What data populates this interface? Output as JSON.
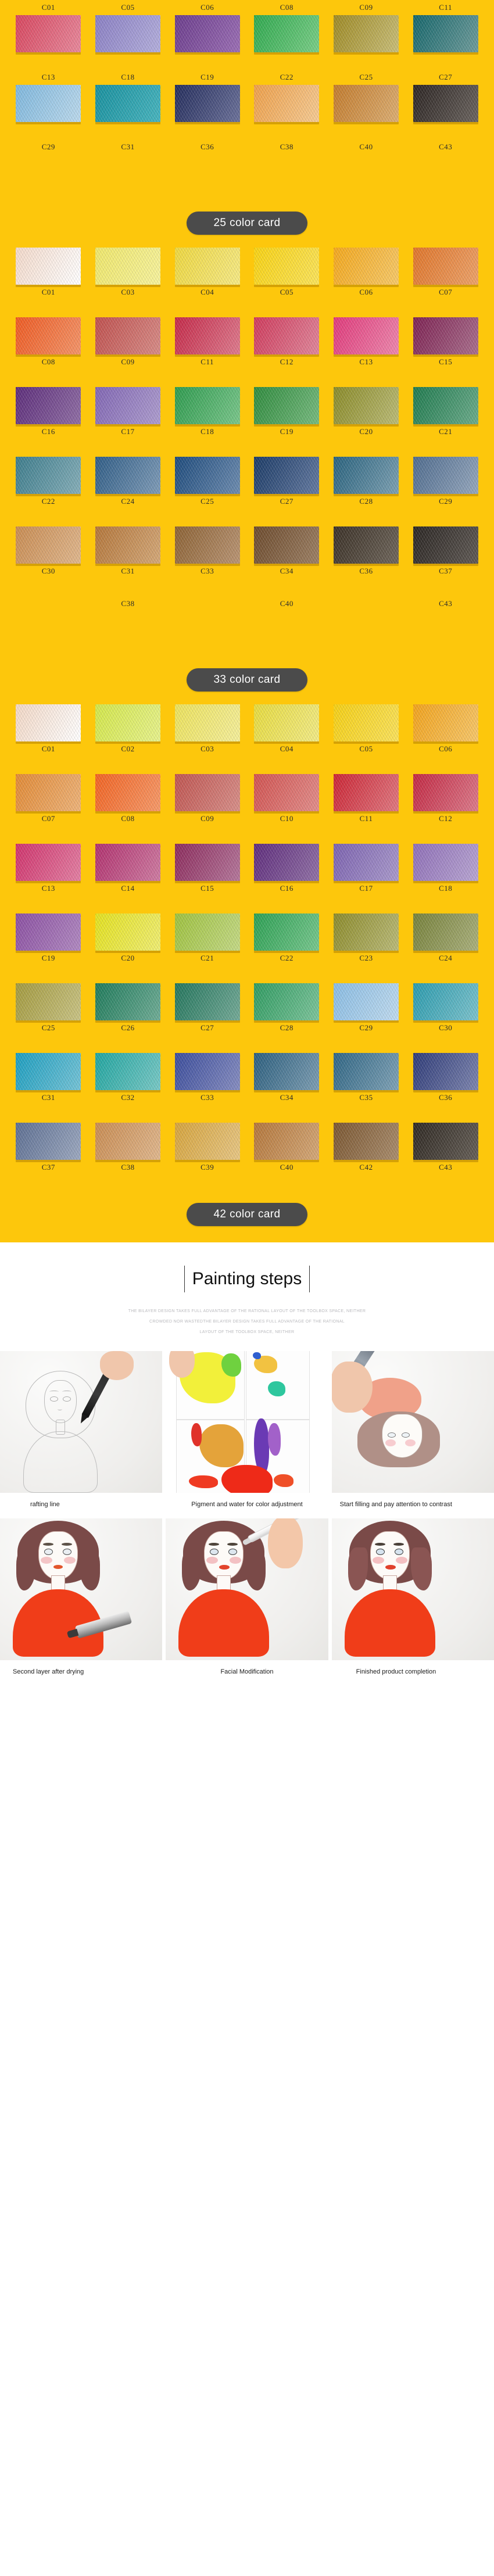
{
  "theme": {
    "background_yellow": "#FDC70C",
    "banner_bg": "#4B4B4B",
    "banner_text": "#FFFFFF",
    "label_text": "#2B2B2B"
  },
  "sections": [
    {
      "id": "card-25",
      "banner": "25 color card",
      "label_position_rows": [
        "above",
        "above",
        "above"
      ],
      "rows": [
        {
          "labels_above": true,
          "cells": [
            {
              "label": "C01",
              "color": "#D8455E",
              "color2": "#E8889B"
            },
            {
              "label": "C05",
              "color": "#8A7FC4",
              "color2": "#B3AEDC"
            },
            {
              "label": "C06",
              "color": "#6B3C8C",
              "color2": "#9A6DB4"
            },
            {
              "label": "C08",
              "color": "#2EA94E",
              "color2": "#79CE86"
            },
            {
              "label": "C09",
              "color": "#9E8A24",
              "color2": "#C9BE78"
            },
            {
              "label": "C11",
              "color": "#14666B",
              "color2": "#6E9B9A"
            }
          ]
        },
        {
          "labels_above": true,
          "cells": [
            {
              "label": "C13",
              "color": "#7FB8DE",
              "color2": "#BBD9EC"
            },
            {
              "label": "C18",
              "color": "#17909E",
              "color2": "#46B4BE"
            },
            {
              "label": "C19",
              "color": "#232C5C",
              "color2": "#6A7099"
            },
            {
              "label": "C22",
              "color": "#EFA04A",
              "color2": "#F6CB93"
            },
            {
              "label": "C25",
              "color": "#C37B2C",
              "color2": "#DCAE72"
            },
            {
              "label": "C27",
              "color": "#2B2422",
              "color2": "#6A635E"
            }
          ]
        },
        {
          "labels_only": true,
          "cells": [
            {
              "label": "C29"
            },
            {
              "label": "C31"
            },
            {
              "label": "C36"
            },
            {
              "label": "C38"
            },
            {
              "label": "C40"
            },
            {
              "label": "C43"
            }
          ]
        }
      ]
    },
    {
      "id": "card-33",
      "banner": "33 color card",
      "rows": [
        {
          "labels_above": false,
          "cells": [
            {
              "label": "C01",
              "color": "#F4DACB",
              "color2": "#FFFFFF"
            },
            {
              "label": "C03",
              "color": "#F0E86B",
              "color2": "#F7F39D"
            },
            {
              "label": "C04",
              "color": "#EFD83F",
              "color2": "#F6EA86"
            },
            {
              "label": "C05",
              "color": "#F9D312",
              "color2": "#FBE45B"
            },
            {
              "label": "C06",
              "color": "#F4A81C",
              "color2": "#F7C969"
            },
            {
              "label": "C07",
              "color": "#E0752A",
              "color2": "#EDA269"
            }
          ]
        },
        {
          "labels_above": false,
          "cells": [
            {
              "label": "C08",
              "color": "#EF5A22",
              "color2": "#F49468"
            },
            {
              "label": "C09",
              "color": "#C0504E",
              "color2": "#D78B86"
            },
            {
              "label": "C11",
              "color": "#C52848",
              "color2": "#DE7A8D"
            },
            {
              "label": "C12",
              "color": "#D03A5C",
              "color2": "#E0869A"
            },
            {
              "label": "C13",
              "color": "#E1397B",
              "color2": "#EE87AD"
            },
            {
              "label": "C15",
              "color": "#7D2152",
              "color2": "#A96E8C"
            }
          ]
        },
        {
          "labels_above": false,
          "cells": [
            {
              "label": "C16",
              "color": "#5C2C7A",
              "color2": "#8F6DA4"
            },
            {
              "label": "C17",
              "color": "#8166B4",
              "color2": "#AD9CCE"
            },
            {
              "label": "C18",
              "color": "#2D9B4E",
              "color2": "#79C68A"
            },
            {
              "label": "C19",
              "color": "#2E8B3D",
              "color2": "#76BA7E"
            },
            {
              "label": "C20",
              "color": "#8A8B28",
              "color2": "#BBBB76"
            },
            {
              "label": "C21",
              "color": "#1E7A4E",
              "color2": "#6BAB8A"
            }
          ]
        },
        {
          "labels_above": false,
          "cells": [
            {
              "label": "C22",
              "color": "#3C7C8C",
              "color2": "#85AEB8"
            },
            {
              "label": "C24",
              "color": "#2E5C86",
              "color2": "#7E9BB7"
            },
            {
              "label": "C25",
              "color": "#1C4A7C",
              "color2": "#6C8BAF"
            },
            {
              "label": "C27",
              "color": "#1A3A66",
              "color2": "#6379A0"
            },
            {
              "label": "C28",
              "color": "#28627E",
              "color2": "#7CA0B2"
            },
            {
              "label": "C29",
              "color": "#4E6B8E",
              "color2": "#95A7BD"
            }
          ]
        },
        {
          "labels_above": false,
          "cells": [
            {
              "label": "C30",
              "color": "#C98C52",
              "color2": "#E0B78D"
            },
            {
              "label": "C31",
              "color": "#B4763A",
              "color2": "#D4A878"
            },
            {
              "label": "C33",
              "color": "#8C6234",
              "color2": "#B99473"
            },
            {
              "label": "C34",
              "color": "#6C4A2C",
              "color2": "#9C7F63"
            },
            {
              "label": "C36",
              "color": "#3A3026",
              "color2": "#6E655A"
            },
            {
              "label": "C37",
              "color": "#2A2522",
              "color2": "#5F5954"
            }
          ]
        },
        {
          "labels_only": true,
          "cells": [
            {
              "label": ""
            },
            {
              "label": "C38"
            },
            {
              "label": ""
            },
            {
              "label": "C40"
            },
            {
              "label": ""
            },
            {
              "label": "C43"
            }
          ]
        }
      ]
    },
    {
      "id": "card-42",
      "banner": "42 color card",
      "rows": [
        {
          "labels_above": false,
          "cells": [
            {
              "label": "C01",
              "color": "#F3D8C6",
              "color2": "#FFFFFF"
            },
            {
              "label": "C02",
              "color": "#D4E84A",
              "color2": "#E7F28C"
            },
            {
              "label": "C03",
              "color": "#EDE35C",
              "color2": "#F5EF9B"
            },
            {
              "label": "C04",
              "color": "#E8DC3E",
              "color2": "#F2EB87"
            },
            {
              "label": "C05",
              "color": "#F6D014",
              "color2": "#FAE25C"
            },
            {
              "label": "C06",
              "color": "#F2A31C",
              "color2": "#F7C76A"
            }
          ]
        },
        {
          "labels_above": false,
          "cells": [
            {
              "label": "C07",
              "color": "#E28A35",
              "color2": "#EEB379"
            },
            {
              "label": "C08",
              "color": "#F26322",
              "color2": "#F79968"
            },
            {
              "label": "C09",
              "color": "#C05450",
              "color2": "#D78E88"
            },
            {
              "label": "C10",
              "color": "#D25250",
              "color2": "#E28D8A"
            },
            {
              "label": "C11",
              "color": "#CC2434",
              "color2": "#E07880"
            },
            {
              "label": "C12",
              "color": "#C32742",
              "color2": "#DC7A8A"
            }
          ]
        },
        {
          "labels_above": false,
          "cells": [
            {
              "label": "C13",
              "color": "#D0326C",
              "color2": "#E37FA2"
            },
            {
              "label": "C14",
              "color": "#B1306E",
              "color2": "#CE7BA1"
            },
            {
              "label": "C15",
              "color": "#8C2A5C",
              "color2": "#B4769A"
            },
            {
              "label": "C16",
              "color": "#5E2B7C",
              "color2": "#9070A5"
            },
            {
              "label": "C17",
              "color": "#7C62B0",
              "color2": "#A999CB"
            },
            {
              "label": "C18",
              "color": "#8F6FB8",
              "color2": "#B8A5D2"
            }
          ]
        },
        {
          "labels_above": false,
          "cells": [
            {
              "label": "C19",
              "color": "#8B4FA2",
              "color2": "#B088C0"
            },
            {
              "label": "C20",
              "color": "#E4E21E",
              "color2": "#F0EE72"
            },
            {
              "label": "C21",
              "color": "#9EC23E",
              "color2": "#C4D985"
            },
            {
              "label": "C22",
              "color": "#2BA053",
              "color2": "#77C78D"
            },
            {
              "label": "C23",
              "color": "#8C8B2A",
              "color2": "#BABA78"
            },
            {
              "label": "C24",
              "color": "#76813A",
              "color2": "#AAB07C"
            }
          ]
        },
        {
          "labels_above": false,
          "cells": [
            {
              "label": "C25",
              "color": "#A39A3E",
              "color2": "#C9C384"
            },
            {
              "label": "C26",
              "color": "#1D7A5A",
              "color2": "#6FAC95"
            },
            {
              "label": "C27",
              "color": "#22755C",
              "color2": "#73A996"
            },
            {
              "label": "C28",
              "color": "#2E9B61",
              "color2": "#7CC49A"
            },
            {
              "label": "C29",
              "color": "#8ABDE4",
              "color2": "#C0DBEF"
            },
            {
              "label": "C30",
              "color": "#2A9BAE",
              "color2": "#7CC2CC"
            }
          ]
        },
        {
          "labels_above": false,
          "cells": [
            {
              "label": "C31",
              "color": "#1B9EC0",
              "color2": "#74C3D6"
            },
            {
              "label": "C32",
              "color": "#1FA5A0",
              "color2": "#78C8C5"
            },
            {
              "label": "C33",
              "color": "#3A4C9C",
              "color2": "#858CC0"
            },
            {
              "label": "C34",
              "color": "#2A5E7E",
              "color2": "#7C9DB2"
            },
            {
              "label": "C35",
              "color": "#2E6584",
              "color2": "#7FA2B6"
            },
            {
              "label": "C36",
              "color": "#2D3A78",
              "color2": "#7C84AE"
            }
          ]
        },
        {
          "labels_above": false,
          "cells": [
            {
              "label": "C37",
              "color": "#5C6E92",
              "color2": "#9CA8BF"
            },
            {
              "label": "C38",
              "color": "#C98C52",
              "color2": "#E0B78D"
            },
            {
              "label": "C39",
              "color": "#D6A43C",
              "color2": "#E7C684"
            },
            {
              "label": "C40",
              "color": "#B4763A",
              "color2": "#D4A878"
            },
            {
              "label": "C42",
              "color": "#7A5630",
              "color2": "#A98C6C"
            },
            {
              "label": "C43",
              "color": "#2E2822",
              "color2": "#655E56"
            }
          ]
        }
      ]
    }
  ],
  "painting_steps": {
    "title": "Painting steps",
    "subtitle_lines": [
      "THE BILAYER DESIGN TAKES FULL ADVANTAGE OF THE RATIONAL LAYOUT OF THE TOOLBOX SPACE, NEITHER",
      "CROWDED NOR WASTEDTHE BILAYER DESIGN TAKES FULL ADVANTAGE OF THE RATIONAL",
      "LAYOUT OF THE TOOLBOX SPACE, NEITHER"
    ],
    "steps": [
      {
        "caption": "rafting line"
      },
      {
        "caption": "Pigment and water for color adjustment"
      },
      {
        "caption": "Start filling and pay attention to contrast"
      },
      {
        "caption": "Second layer after drying"
      },
      {
        "caption": "Facial Modification"
      },
      {
        "caption": "Finished product completion"
      }
    ]
  }
}
